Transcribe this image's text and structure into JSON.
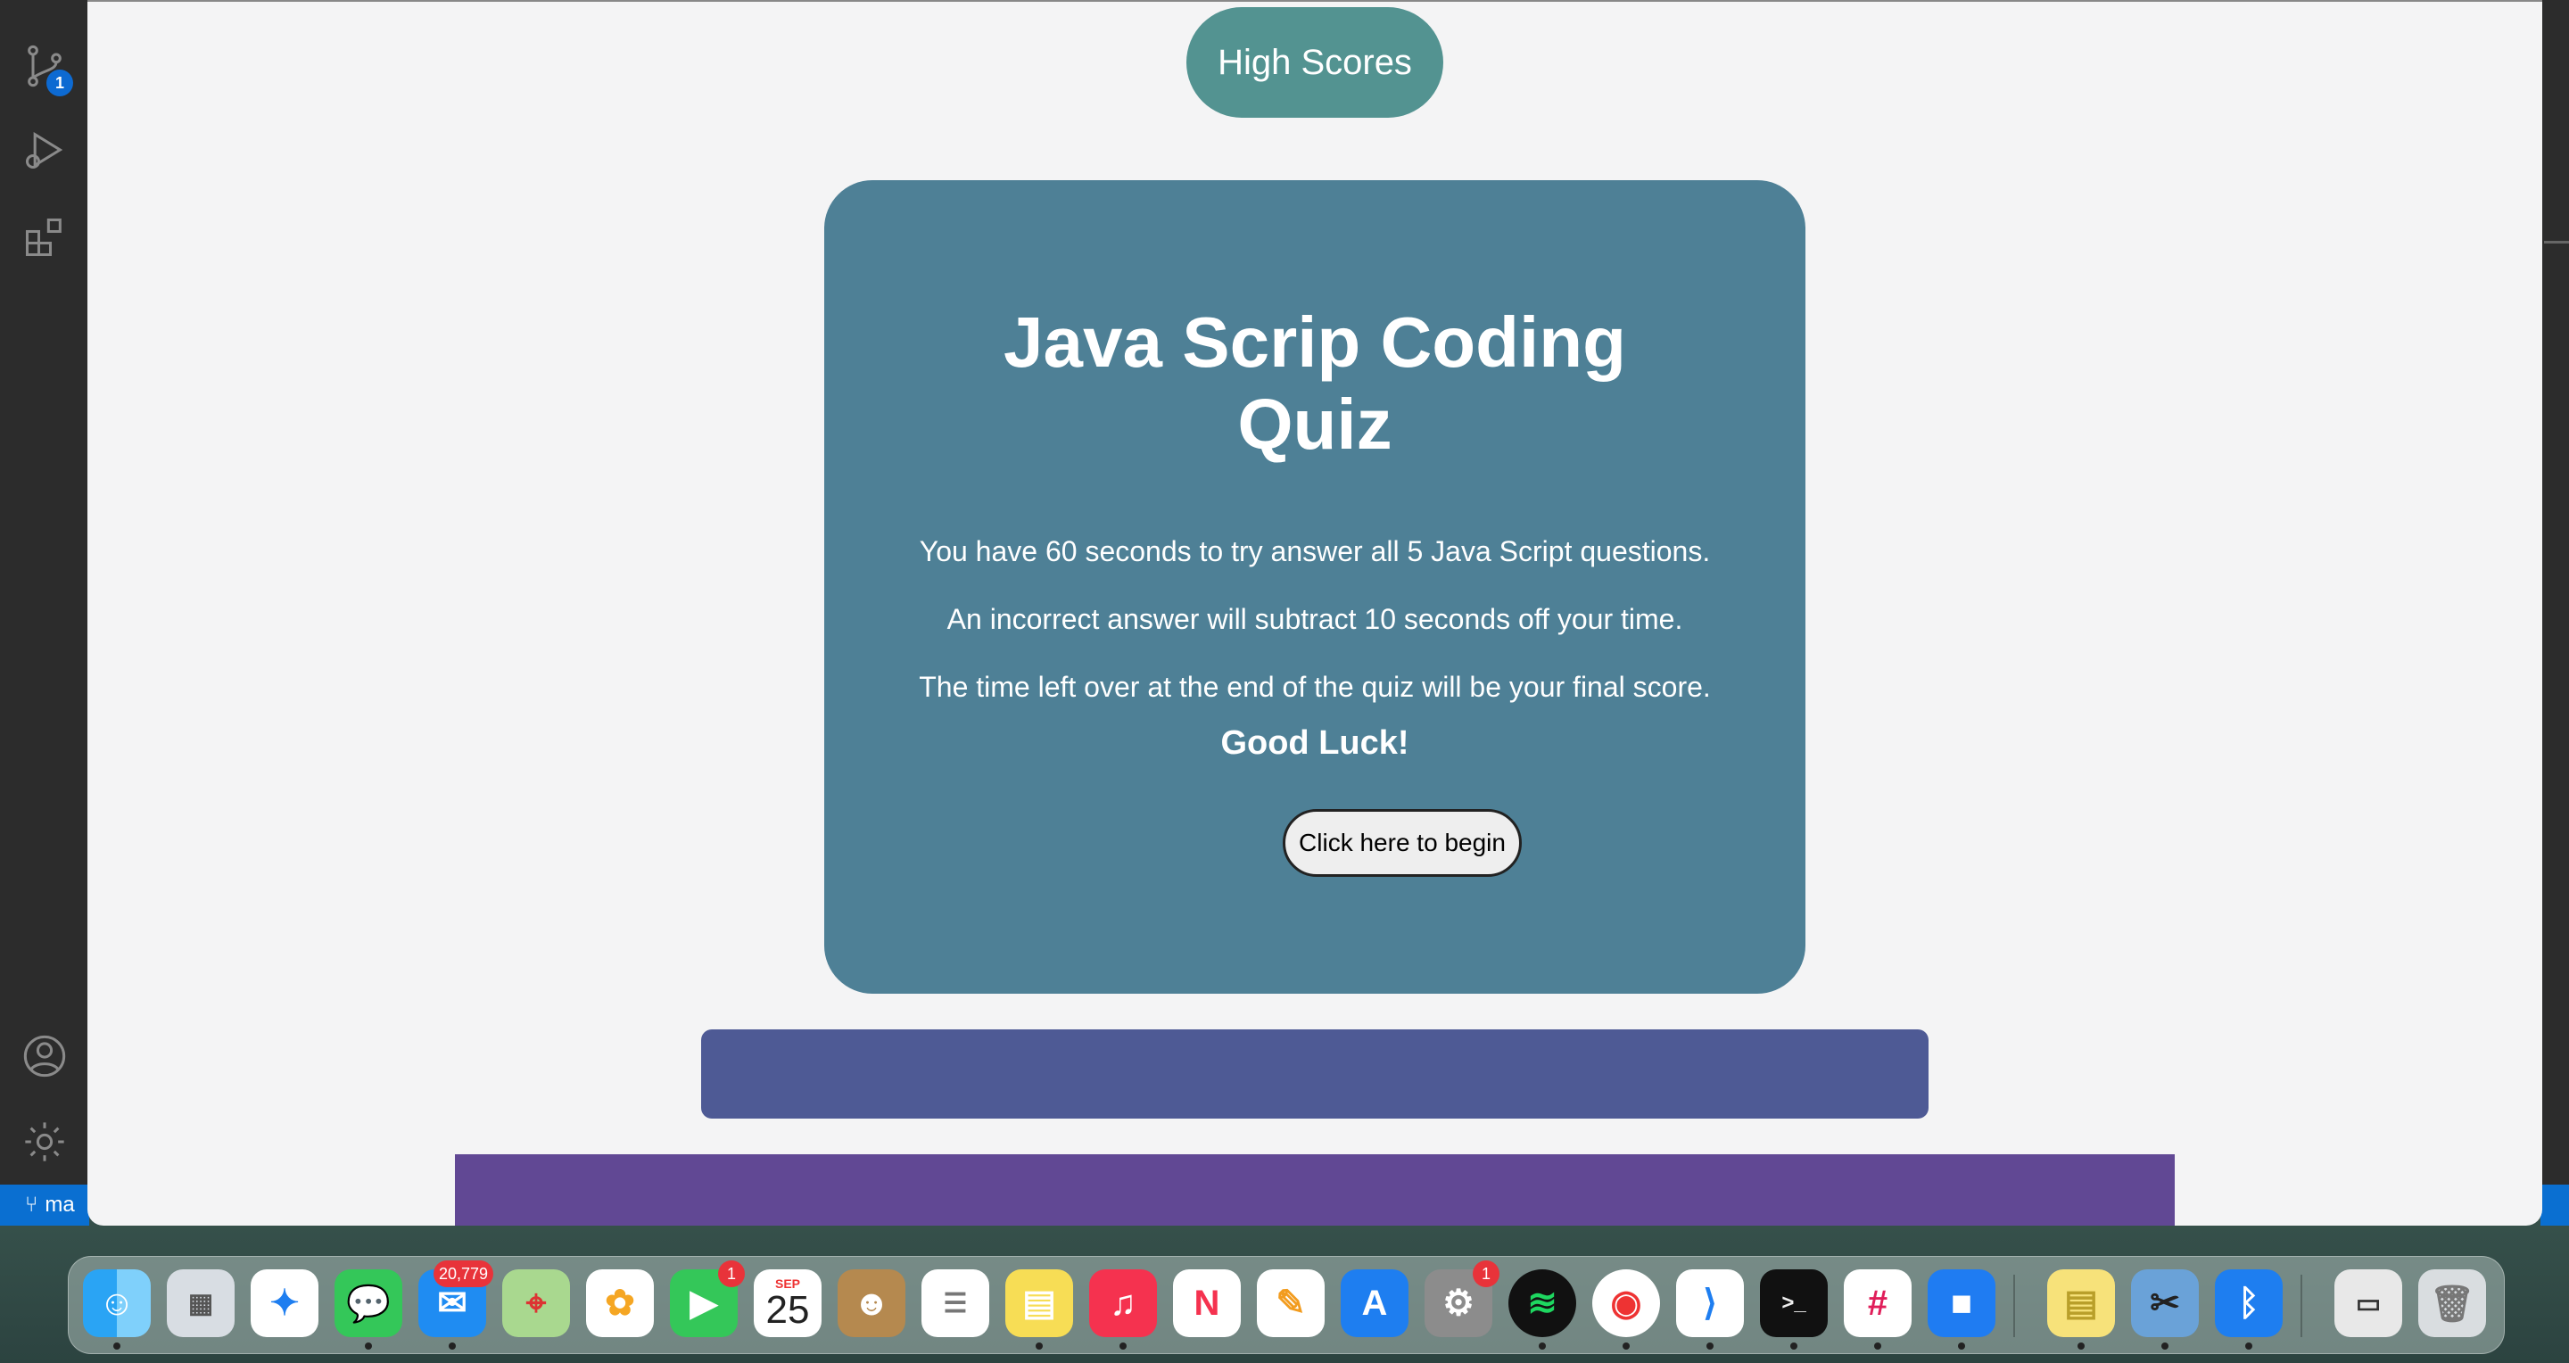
{
  "app": {
    "high_scores_label": "High Scores",
    "quiz": {
      "title": "Java Scrip Coding Quiz",
      "lines": [
        "You have 60 seconds to try answer all 5 Java Script questions.",
        "An incorrect answer will subtract 10 seconds off your time.",
        "The time left over at the end of the quiz will be your final score."
      ],
      "good_luck": "Good Luck!",
      "begin_label": "Click here to begin"
    }
  },
  "editor": {
    "source_control_badge": "1",
    "branch_label": "ma"
  },
  "dock": {
    "mail_badge": "20,779",
    "facetime_badge": "1",
    "settings_badge": "1",
    "calendar_month": "SEP",
    "calendar_day": "25",
    "apps": [
      "Finder",
      "Launchpad",
      "Safari",
      "Messages",
      "Mail",
      "Maps",
      "Photos",
      "FaceTime",
      "Calendar",
      "Contacts",
      "Reminders",
      "Notes",
      "Music",
      "News",
      "Pages",
      "App Store",
      "System Preferences",
      "Spotify",
      "Chrome",
      "VS Code",
      "Terminal",
      "Slack",
      "Zoom",
      "Stickies",
      "Utility",
      "Bluetooth",
      "Screenshot",
      "Trash"
    ]
  },
  "colors": {
    "high_scores_bg": "#539391",
    "card_bg": "#4e8096",
    "bar_blue": "#4e5a95",
    "bar_purple": "#614894",
    "page_bg": "#f4f4f5"
  }
}
